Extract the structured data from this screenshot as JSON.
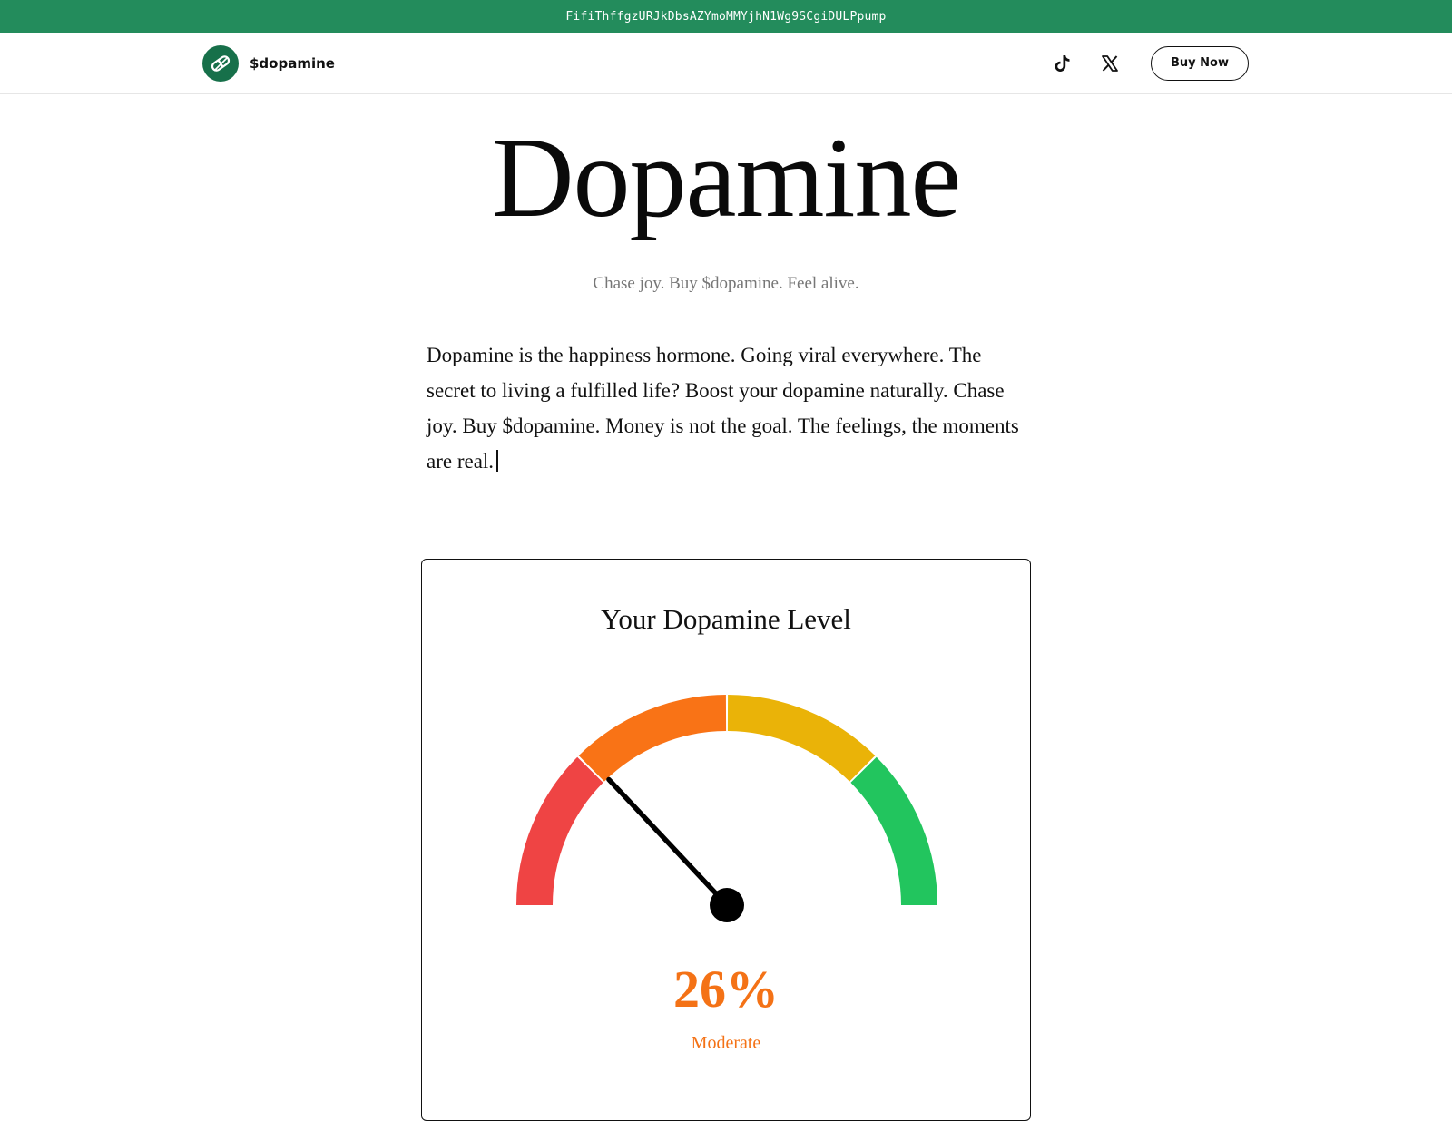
{
  "banner": {
    "contract_address": "FifiThffgzURJkDbsAZYmoMMYjhN1Wg9SCgiDULPpump"
  },
  "nav": {
    "brand_name": "$dopamine",
    "logo_icon": "pill-icon",
    "social": [
      {
        "name": "TikTok",
        "icon": "tiktok-icon"
      },
      {
        "name": "X",
        "icon": "x-icon"
      }
    ],
    "buy_label": "Buy Now"
  },
  "hero": {
    "title": "Dopamine",
    "tagline": "Chase joy. Buy $dopamine. Feel alive.",
    "description": "Dopamine is the happiness hormone. Going viral everywhere. The secret to living a fulfilled life? Boost your dopamine naturally. Chase joy. Buy $dopamine. Money is not the goal. The feelings, the moments are real."
  },
  "gauge": {
    "title": "Your Dopamine Level",
    "value_label": "26%",
    "value_fraction": 0.26,
    "status": "Moderate",
    "segments": [
      {
        "color": "#ef4444",
        "from": 0.0,
        "to": 0.25
      },
      {
        "color": "#f97316",
        "from": 0.25,
        "to": 0.5
      },
      {
        "color": "#eab308",
        "from": 0.5,
        "to": 0.75
      },
      {
        "color": "#22c55e",
        "from": 0.75,
        "to": 1.0
      }
    ],
    "status_color": "#f47216"
  },
  "colors": {
    "brand_green": "#238c5c",
    "logo_green": "#17704a"
  }
}
